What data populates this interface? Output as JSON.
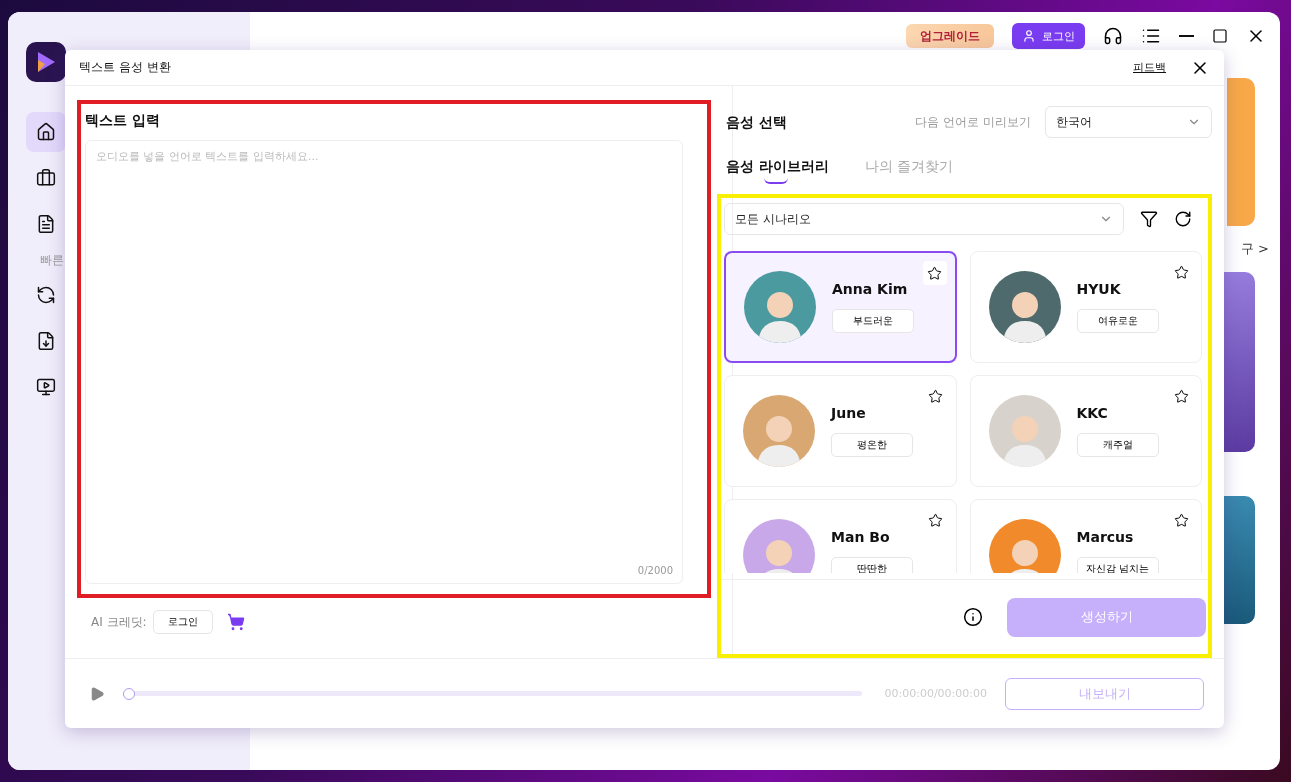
{
  "app": {
    "sidebar": {
      "items": [
        {
          "selected": true
        },
        {
          "selected": false
        },
        {
          "selected": false
        }
      ],
      "section_label": "빠른",
      "quick_items": [
        {
          "selected": false
        },
        {
          "selected": false
        },
        {
          "selected": false
        }
      ]
    },
    "top_bar": {
      "upgrade": "업그레이드",
      "login": "로그인"
    },
    "background_link": "구 >"
  },
  "dialog": {
    "title": "텍스트 음성 변환",
    "feedback": "피드백",
    "text_input": {
      "heading": "텍스트 입력",
      "placeholder": "오디오를 넣을 언어로 텍스트를 입력하세요...",
      "counter": "0/2000"
    },
    "credits": {
      "label": "AI 크레딧:",
      "login": "로그인"
    },
    "voice": {
      "heading": "음성 선택",
      "preview_label": "다음 언어로 미리보기",
      "language": "한국어",
      "tabs": [
        {
          "label": "음성 라이브러리",
          "selected": true
        },
        {
          "label": "나의 즐겨찾기",
          "selected": false
        }
      ],
      "scenario": "모든 시나리오",
      "voices": [
        {
          "name": "Anna Kim",
          "tag": "부드러운",
          "selected": true,
          "color": "#4a9aa0"
        },
        {
          "name": "HYUK",
          "tag": "여유로운",
          "selected": false,
          "color": "#4e6a6c"
        },
        {
          "name": "June",
          "tag": "평온한",
          "selected": false,
          "color": "#d9a872"
        },
        {
          "name": "KKC",
          "tag": "캐주얼",
          "selected": false,
          "color": "#d8d2cc"
        },
        {
          "name": "Man Bo",
          "tag": "딴딴한",
          "selected": false,
          "color": "#c8a8e8"
        },
        {
          "name": "Marcus",
          "tag": "자신감 넘치는",
          "selected": false,
          "color": "#f08a2a"
        }
      ],
      "generate": "생성하기"
    },
    "player": {
      "level": 0,
      "time": "00:00:00/00:00:00",
      "export": "내보내기"
    }
  }
}
